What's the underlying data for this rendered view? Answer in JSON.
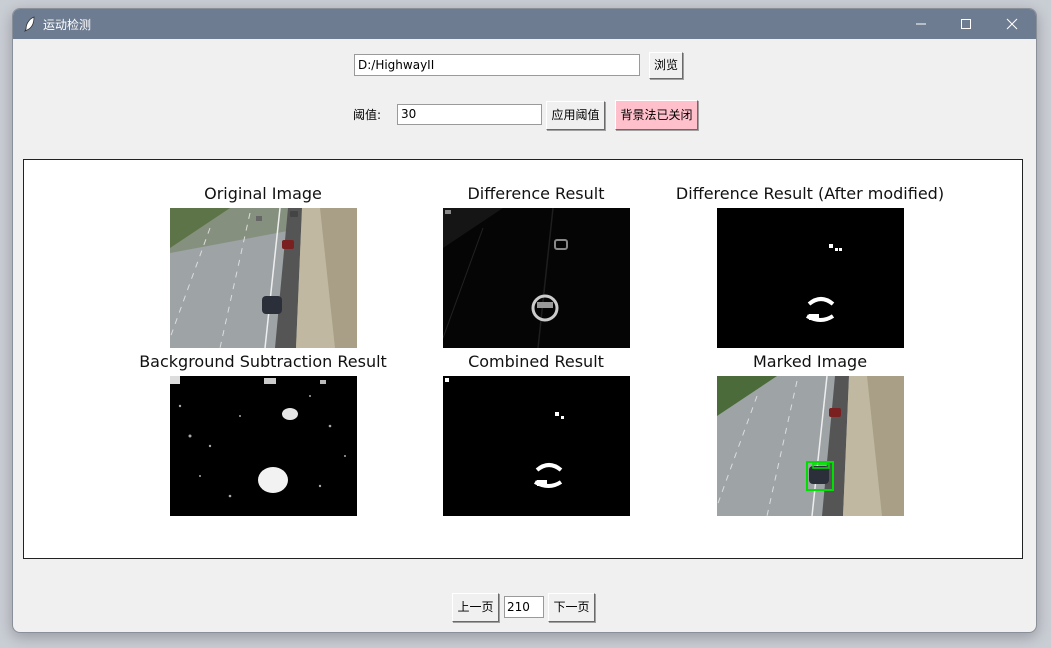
{
  "window": {
    "title": "运动检测"
  },
  "toolbar": {
    "path_value": "D:/HighwayII",
    "browse_label": "浏览",
    "threshold_label": "阈值:",
    "threshold_value": "30",
    "apply_label": "应用阈值",
    "bg_toggle_label": "背景法已关闭",
    "bg_toggle_color": "#ffc0cb"
  },
  "panels": {
    "original": "Original Image",
    "difference": "Difference Result",
    "difference_modified": "Difference Result (After modified)",
    "background_subtraction": "Background Subtraction Result",
    "combined": "Combined Result",
    "marked": "Marked Image"
  },
  "pager": {
    "prev_label": "上一页",
    "page_value": "210",
    "next_label": "下一页"
  },
  "colors": {
    "titlebar": "#6e7c92",
    "detection_box": "#00e000"
  }
}
